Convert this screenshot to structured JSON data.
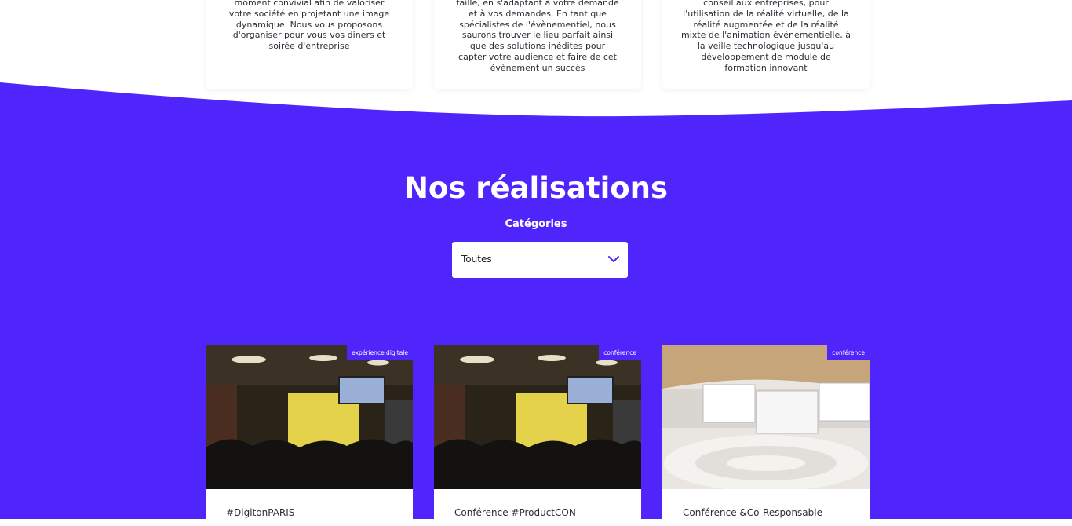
{
  "colors": {
    "accent": "#5025fb",
    "card": "#ffffff",
    "text": "#2d2d35"
  },
  "services": [
    {
      "lines": [
        "moment convivial afin de valoriser",
        "votre société en projetant une image",
        "dynamique. Nous vous proposons",
        "d'organiser pour vous vos diners et",
        "soirée d'entreprise"
      ]
    },
    {
      "lines": [
        "taille, en s'adaptant à votre demande",
        "et à vos demandes. En tant que",
        "spécialistes de l'évènementiel, nous",
        "saurons trouver le lieu parfait ainsi",
        "que des solutions inédites pour",
        "capter votre audience et faire de cet",
        "évènement un succès"
      ]
    },
    {
      "lines": [
        "conseil aux entreprises, pour",
        "l'utilisation de la réalité virtuelle, de la",
        "réalité augmentée et de la réalité",
        "mixte de l'animation événementielle, à",
        "la veille technologique jusqu'au",
        "développement de module de",
        "formation innovant"
      ]
    }
  ],
  "realisations": {
    "title": "Nos réalisations",
    "filter_label": "Catégories",
    "filter_value": "Toutes",
    "chevron_icon": "chevron-down-icon"
  },
  "projects": [
    {
      "tag": "expérience digitale",
      "title": "#DigitonPARIS"
    },
    {
      "tag": "conférence",
      "title": "Conférence #ProductCON"
    },
    {
      "tag": "conférence",
      "title": "Conférence &Co-Responsable"
    }
  ]
}
